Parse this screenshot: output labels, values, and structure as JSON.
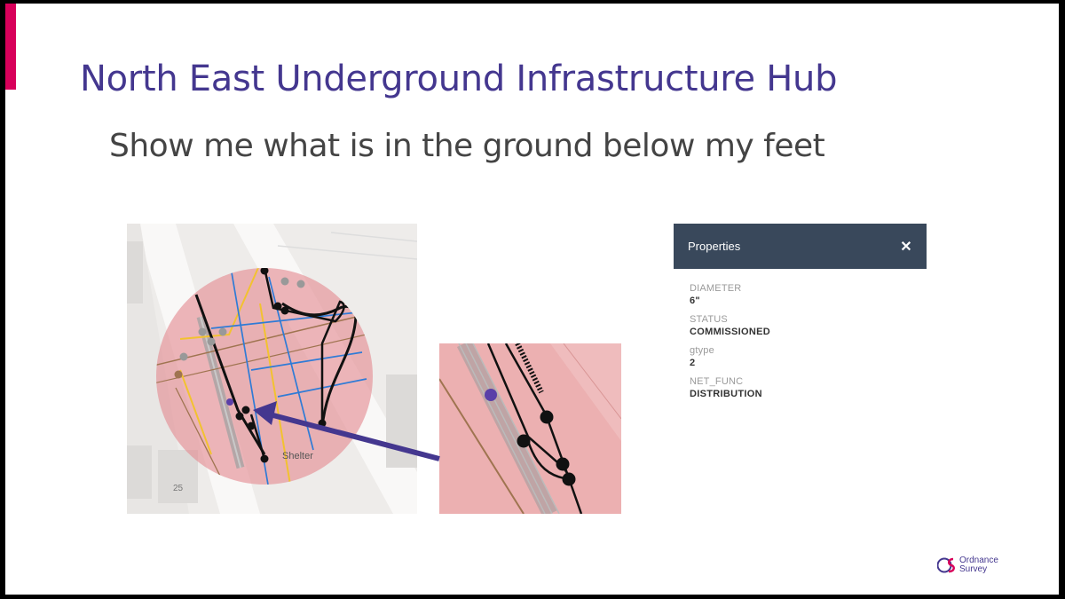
{
  "slide": {
    "title": "North East Underground Infrastructure Hub",
    "subtitle": "Show me what is in the ground below my feet",
    "accent_color": "#d8005a",
    "title_color": "#44378f"
  },
  "map": {
    "labels": {
      "shelter": "Shelter",
      "house_number": "25"
    }
  },
  "properties_panel": {
    "title": "Properties",
    "close_icon": "close-icon",
    "items": [
      {
        "key": "DIAMETER",
        "value": "6\""
      },
      {
        "key": "STATUS",
        "value": "COMMISSIONED"
      },
      {
        "key": "gtype",
        "value": "2"
      },
      {
        "key": "NET_FUNC",
        "value": "DISTRIBUTION"
      }
    ]
  },
  "logo": {
    "line1": "Ordnance",
    "line2": "Survey"
  }
}
